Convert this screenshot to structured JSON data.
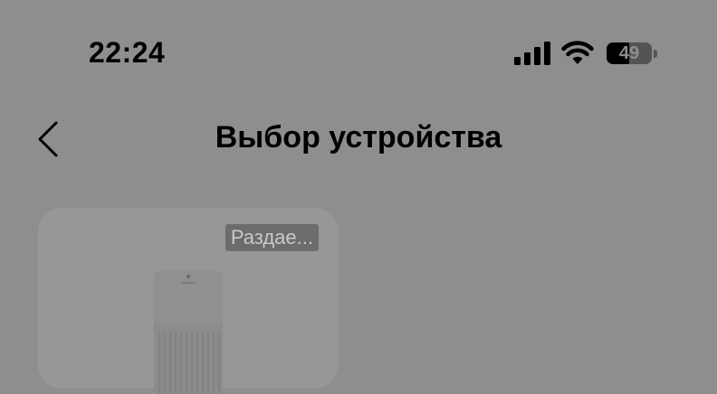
{
  "status_bar": {
    "time": "22:24",
    "battery_percent": 49,
    "battery_label": "49",
    "icons": [
      "cellular-signal-icon",
      "wifi-icon",
      "battery-icon"
    ]
  },
  "nav": {
    "title": "Выбор устройства",
    "back_icon": "chevron-left-icon"
  },
  "devices": [
    {
      "badge": "Раздае...",
      "image_icon": "air-purifier-icon"
    }
  ]
}
